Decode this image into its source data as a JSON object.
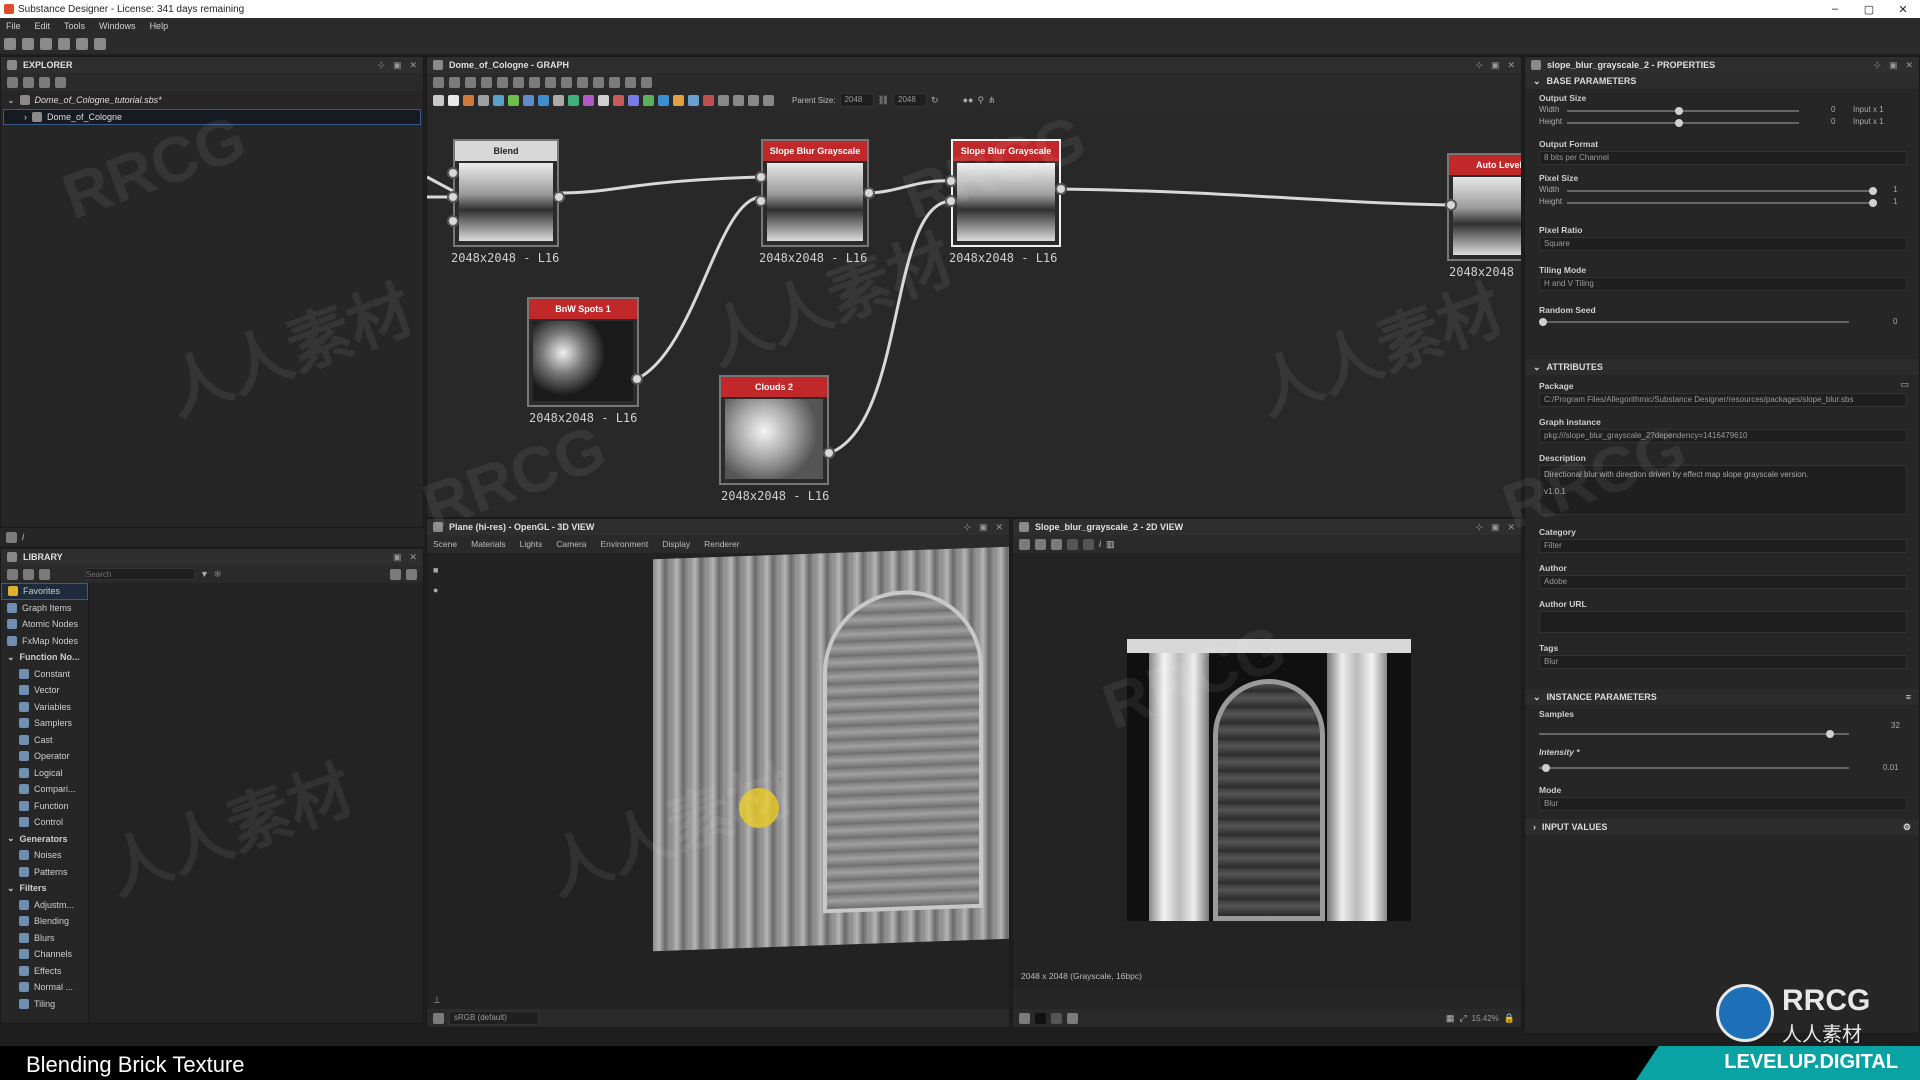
{
  "app": {
    "title": "Substance Designer - License: 341 days remaining",
    "menu": [
      "File",
      "Edit",
      "Tools",
      "Windows",
      "Help"
    ]
  },
  "explorer": {
    "title": "EXPLORER",
    "file": "Dome_of_Cologne_tutorial.sbs*",
    "graph": "Dome_of_Cologne"
  },
  "graph": {
    "title": "Dome_of_Cologne - GRAPH",
    "parent_size_label": "Parent Size:",
    "parent_size": "2048",
    "size2": "2048",
    "nodes": [
      {
        "name": "Blend",
        "res": "2048x2048 - L16"
      },
      {
        "name": "Slope Blur Grayscale",
        "res": "2048x2048 - L16"
      },
      {
        "name": "Slope Blur Grayscale",
        "res": "2048x2048 - L16"
      },
      {
        "name": "Auto Levels",
        "res": "2048x2048"
      },
      {
        "name": "BnW Spots 1",
        "res": "2048x2048 - L16"
      },
      {
        "name": "Clouds 2",
        "res": "2048x2048 - L16"
      }
    ]
  },
  "library": {
    "title": "LIBRARY",
    "search_placeholder": "Search",
    "items": [
      {
        "label": "Favorites",
        "type": "top"
      },
      {
        "label": "Graph Items",
        "type": "top"
      },
      {
        "label": "Atomic Nodes",
        "type": "top"
      },
      {
        "label": "FxMap Nodes",
        "type": "top"
      },
      {
        "label": "Function No...",
        "type": "group"
      },
      {
        "label": "Constant",
        "type": "child"
      },
      {
        "label": "Vector",
        "type": "child"
      },
      {
        "label": "Variables",
        "type": "child"
      },
      {
        "label": "Samplers",
        "type": "child"
      },
      {
        "label": "Cast",
        "type": "child"
      },
      {
        "label": "Operator",
        "type": "child"
      },
      {
        "label": "Logical",
        "type": "child"
      },
      {
        "label": "Compari...",
        "type": "child"
      },
      {
        "label": "Function",
        "type": "child"
      },
      {
        "label": "Control",
        "type": "child"
      },
      {
        "label": "Generators",
        "type": "group"
      },
      {
        "label": "Noises",
        "type": "child"
      },
      {
        "label": "Patterns",
        "type": "child"
      },
      {
        "label": "Filters",
        "type": "group"
      },
      {
        "label": "Adjustm...",
        "type": "child"
      },
      {
        "label": "Blending",
        "type": "child"
      },
      {
        "label": "Blurs",
        "type": "child"
      },
      {
        "label": "Channels",
        "type": "child"
      },
      {
        "label": "Effects",
        "type": "child"
      },
      {
        "label": "Normal ...",
        "type": "child"
      },
      {
        "label": "Tiling",
        "type": "child"
      }
    ]
  },
  "view3d": {
    "title": "Plane (hi-res) - OpenGL - 3D VIEW",
    "menu": [
      "Scene",
      "Materials",
      "Lights",
      "Camera",
      "Environment",
      "Display",
      "Renderer"
    ],
    "colorspace": "sRGB (default)"
  },
  "view2d": {
    "title": "Slope_blur_grayscale_2 - 2D VIEW",
    "status": "2048 x 2048 (Grayscale, 16bpc)",
    "zoom": "15.42%"
  },
  "properties": {
    "title": "slope_blur_grayscale_2 - PROPERTIES",
    "base": {
      "header": "BASE PARAMETERS",
      "output_size": "Output Size",
      "width": "Width",
      "height": "Height",
      "os_w_val": "0",
      "os_h_val": "0",
      "os_w_mode": "Input x 1",
      "os_h_mode": "Input x 1",
      "output_format": "Output Format",
      "output_format_val": "8 bits per Channel",
      "pixel_size": "Pixel Size",
      "ps_w": "1",
      "ps_h": "1",
      "pixel_ratio": "Pixel Ratio",
      "pixel_ratio_val": "Square",
      "tiling_mode": "Tiling Mode",
      "tiling_mode_val": "H and V Tiling",
      "random_seed": "Random Seed",
      "random_seed_val": "0"
    },
    "attributes": {
      "header": "ATTRIBUTES",
      "package": "Package",
      "package_val": "C:/Program Files/Allegorithmic/Substance Designer/resources/packages/slope_blur.sbs",
      "graph_instance": "Graph instance",
      "graph_instance_val": "pkg:///slope_blur_grayscale_2?dependency=1416479610",
      "description": "Description",
      "description_val": "Directional blur with direction driven by effect map slope grayscale version.",
      "version": "v1.0.1",
      "category": "Category",
      "category_val": "Filter",
      "author": "Author",
      "author_val": "Adobe",
      "author_url": "Author URL",
      "tags": "Tags",
      "tags_val": "Blur"
    },
    "instance": {
      "header": "INSTANCE PARAMETERS",
      "samples": "Samples",
      "samples_val": "32",
      "samples_level": 0.95,
      "intensity": "Intensity *",
      "intensity_val": "0.01",
      "intensity_level": 0.01,
      "mode": "Mode",
      "mode_val": "Blur"
    },
    "input_values": "INPUT VALUES"
  },
  "caption": "Blending Brick Texture",
  "watermarks": {
    "rrcg": "RRCG",
    "cn": "人人素材",
    "levelup": "LEVELUP.DIGITAL",
    "logo_text": "RRCG",
    "logo_cn": "人人素材"
  }
}
